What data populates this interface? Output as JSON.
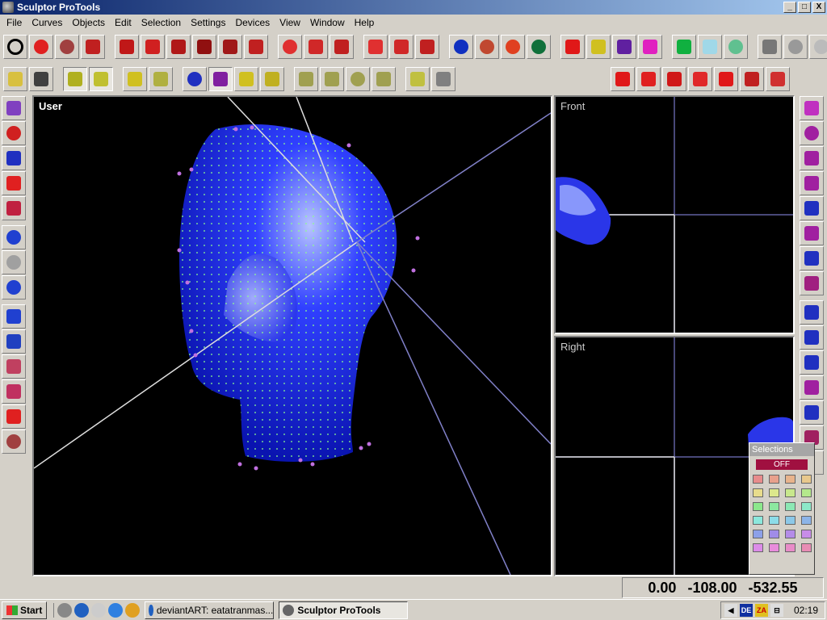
{
  "window": {
    "title": "Sculptor ProTools",
    "min": "_",
    "max": "□",
    "close": "X"
  },
  "menu": [
    "File",
    "Curves",
    "Objects",
    "Edit",
    "Selection",
    "Settings",
    "Devices",
    "View",
    "Window",
    "Help"
  ],
  "viewports": {
    "user": "User",
    "front": "Front",
    "right": "Right"
  },
  "coords": {
    "x": "0.00",
    "y": "-108.00",
    "z": "-532.55"
  },
  "selections": {
    "title": "Selections",
    "off": "OFF",
    "colors": [
      "#e88c8c",
      "#e8a08c",
      "#e8b48c",
      "#e8c88c",
      "#e8dc8c",
      "#dce88c",
      "#c8e88c",
      "#b4e88c",
      "#8ce88c",
      "#8ce8a0",
      "#8ce8b4",
      "#8ce8c8",
      "#8ce8dc",
      "#8cdce8",
      "#8cc8e8",
      "#8cb4e8",
      "#8ca0e8",
      "#a08ce8",
      "#b48ce8",
      "#c88ce8",
      "#dc8ce8",
      "#e88cdc",
      "#e88cc8",
      "#e88cb4"
    ]
  },
  "taskbar": {
    "start": "Start",
    "tasks": [
      {
        "label": "deviantART: eatatranmas..."
      },
      {
        "label": "Sculptor ProTools"
      }
    ],
    "tray": [
      "DE",
      "ZA"
    ],
    "clock": "02:19"
  }
}
